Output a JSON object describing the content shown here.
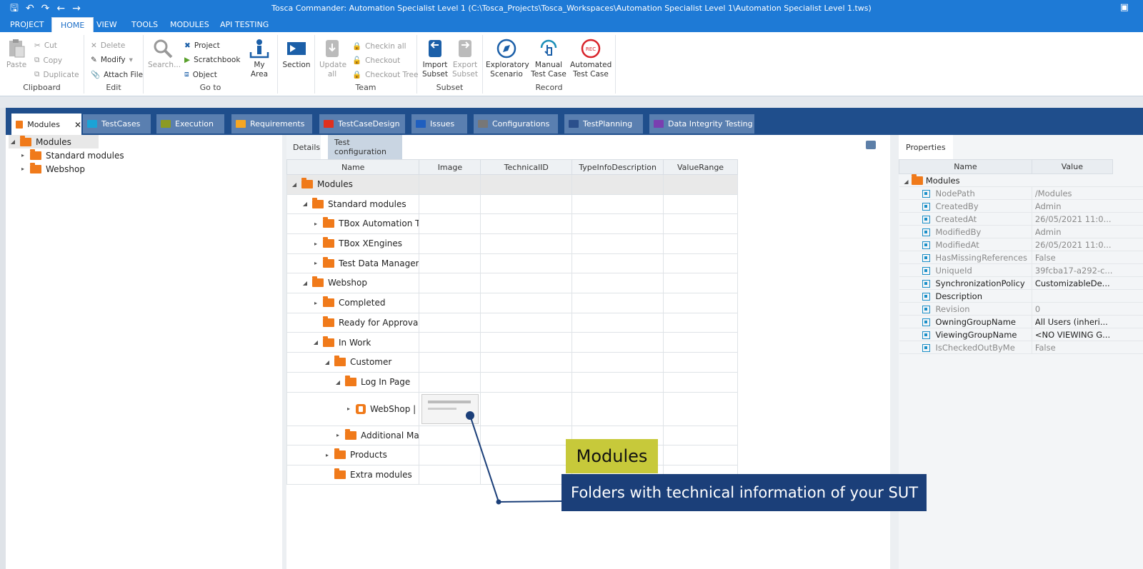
{
  "window": {
    "title": "Tosca Commander: Automation Specialist Level 1 (C:\\Tosca_Projects\\Tosca_Workspaces\\Automation Specialist Level 1\\Automation Specialist Level 1.tws)"
  },
  "menu": [
    "PROJECT",
    "HOME",
    "VIEW",
    "TOOLS",
    "MODULES",
    "API TESTING"
  ],
  "ribbon": {
    "clipboard": {
      "label": "Clipboard",
      "paste": "Paste",
      "cut": "Cut",
      "copy": "Copy",
      "duplicate": "Duplicate"
    },
    "edit": {
      "label": "Edit",
      "delete": "Delete",
      "modify": "Modify",
      "attach_file": "Attach File"
    },
    "goto": {
      "label": "Go to",
      "search": "Search...",
      "project": "Project",
      "scratchbook": "Scratchbook",
      "object": "Object",
      "my_area": "My Area"
    },
    "section": {
      "label": "Section"
    },
    "team": {
      "label": "Team",
      "update_all_1": "Update",
      "update_all_2": "all",
      "checkin_all": "Checkin all",
      "checkout": "Checkout",
      "checkout_tree": "Checkout Tree"
    },
    "subset": {
      "label": "Subset",
      "import_1": "Import",
      "import_2": "Subset",
      "export_1": "Export",
      "export_2": "Subset"
    },
    "record": {
      "label": "Record",
      "exploratory_1": "Exploratory",
      "exploratory_2": "Scenario",
      "manual_1": "Manual",
      "manual_2": "Test Case",
      "automated_1": "Automated",
      "automated_2": "Test Case",
      "rec_badge": "REC"
    }
  },
  "tabs": [
    {
      "label": "Modules",
      "color": "#f07a1a",
      "close": "✕"
    },
    {
      "label": "TestCases",
      "color": "#1ba3d6"
    },
    {
      "label": "Execution",
      "color": "#8c9a24"
    },
    {
      "label": "Requirements",
      "color": "#f5a623"
    },
    {
      "label": "TestCaseDesign",
      "color": "#e0301e"
    },
    {
      "label": "Issues",
      "color": "#1f5fbf"
    },
    {
      "label": "Configurations",
      "color": "#777777"
    },
    {
      "label": "TestPlanning",
      "color": "#2b4f8c"
    },
    {
      "label": "Data Integrity Testing",
      "color": "#7a3fb0"
    }
  ],
  "left_tree": [
    "Modules",
    "Standard modules",
    "Webshop"
  ],
  "details": {
    "tab_details": "Details",
    "tab_config": "Test configuration",
    "columns": [
      "Name",
      "Image",
      "TechnicalID",
      "TypeInfoDescription",
      "ValueRange"
    ],
    "rows": [
      {
        "name": "Modules",
        "arrow": "◢"
      },
      {
        "name": "Standard modules",
        "arrow": "◢"
      },
      {
        "name": "TBox Automation To...",
        "arrow": "▸"
      },
      {
        "name": "TBox XEngines",
        "arrow": "▸"
      },
      {
        "name": "Test Data Managem...",
        "arrow": "▸"
      },
      {
        "name": "Webshop",
        "arrow": "◢"
      },
      {
        "name": "Completed",
        "arrow": "▸"
      },
      {
        "name": "Ready for Approval",
        "arrow": ""
      },
      {
        "name": "In Work",
        "arrow": "◢"
      },
      {
        "name": "Customer",
        "arrow": "◢"
      },
      {
        "name": "Log In Page",
        "arrow": "◢"
      },
      {
        "name": "WebShop | ...",
        "arrow": "▸"
      },
      {
        "name": "Additional Ma...",
        "arrow": "▸"
      },
      {
        "name": "Products",
        "arrow": "▸"
      },
      {
        "name": "Extra modules",
        "arrow": ""
      }
    ]
  },
  "properties": {
    "tab": "Properties",
    "col_name": "Name",
    "col_value": "Value",
    "root": "Modules",
    "rows": [
      {
        "name": "NodePath",
        "value": "/Modules",
        "dim": true
      },
      {
        "name": "CreatedBy",
        "value": "Admin",
        "dim": true
      },
      {
        "name": "CreatedAt",
        "value": "26/05/2021 11:0...",
        "dim": true
      },
      {
        "name": "ModifiedBy",
        "value": "Admin",
        "dim": true
      },
      {
        "name": "ModifiedAt",
        "value": "26/05/2021 11:0...",
        "dim": true
      },
      {
        "name": "HasMissingReferences",
        "value": "False",
        "dim": true
      },
      {
        "name": "UniqueId",
        "value": "39fcba17-a292-c...",
        "dim": true
      },
      {
        "name": "SynchronizationPolicy",
        "value": "CustomizableDe...",
        "dim": false
      },
      {
        "name": "Description",
        "value": "",
        "dim": false
      },
      {
        "name": "Revision",
        "value": "0",
        "dim": true
      },
      {
        "name": "OwningGroupName",
        "value": "All Users (inheri...",
        "dim": false
      },
      {
        "name": "ViewingGroupName",
        "value": "<NO VIEWING G...",
        "dim": false
      },
      {
        "name": "IsCheckedOutByMe",
        "value": "False",
        "dim": true
      }
    ]
  },
  "callout": {
    "title": "Modules",
    "text": "Folders with technical information of your SUT"
  }
}
